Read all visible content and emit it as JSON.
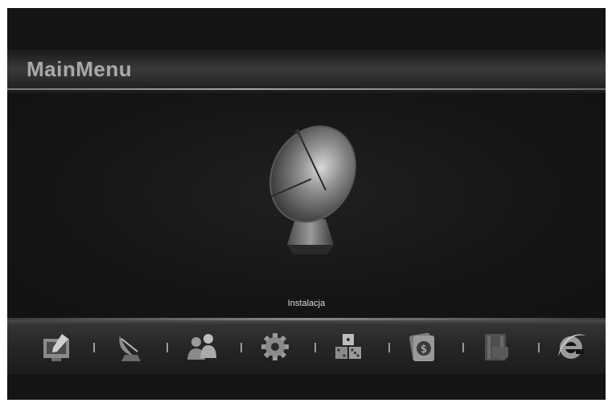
{
  "header": {
    "title": "MainMenu"
  },
  "selected_label": "Instalacja",
  "menu_icons": [
    "edit-screen-icon",
    "satellite-dish-icon",
    "users-icon",
    "settings-gear-icon",
    "games-dice-icon",
    "money-card-icon",
    "film-media-icon",
    "internet-explorer-icon"
  ],
  "colors": {
    "background": "#141414",
    "text": "#a9a9a9",
    "label": "#dcdcdc"
  }
}
